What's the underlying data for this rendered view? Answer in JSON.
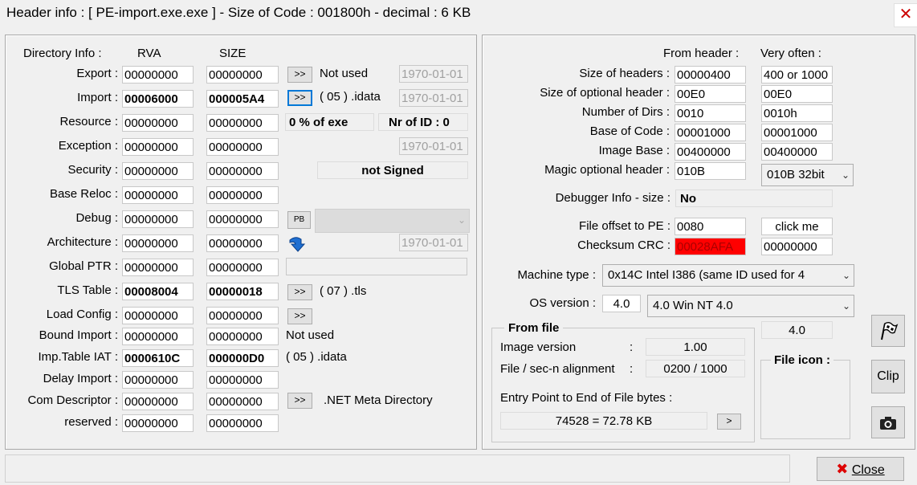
{
  "window": {
    "title": "Header info  : [ PE-import.exe.exe ] - Size of Code : 001800h - decimal : 6 KB",
    "close_glyph": "✕"
  },
  "directory": {
    "header_label": "Directory Info :",
    "rva_label": "RVA",
    "size_label": "SIZE",
    "rows": [
      {
        "label": "Export :",
        "rva": "00000000",
        "size": "00000000",
        "bold": false
      },
      {
        "label": "Import :",
        "rva": "00006000",
        "size": "000005A4",
        "bold": true
      },
      {
        "label": "Resource :",
        "rva": "00000000",
        "size": "00000000",
        "bold": false
      },
      {
        "label": "Exception :",
        "rva": "00000000",
        "size": "00000000",
        "bold": false
      },
      {
        "label": "Security :",
        "rva": "00000000",
        "size": "00000000",
        "bold": false
      },
      {
        "label": "Base Reloc :",
        "rva": "00000000",
        "size": "00000000",
        "bold": false
      },
      {
        "label": "Debug :",
        "rva": "00000000",
        "size": "00000000",
        "bold": false
      },
      {
        "label": "Architecture :",
        "rva": "00000000",
        "size": "00000000",
        "bold": false
      },
      {
        "label": "Global PTR :",
        "rva": "00000000",
        "size": "00000000",
        "bold": false
      },
      {
        "label": "TLS Table :",
        "rva": "00008004",
        "size": "00000018",
        "bold": true
      },
      {
        "label": "Load Config :",
        "rva": "00000000",
        "size": "00000000",
        "bold": false
      },
      {
        "label": "Bound Import :",
        "rva": "00000000",
        "size": "00000000",
        "bold": false
      },
      {
        "label": "Imp.Table IAT :",
        "rva": "0000610C",
        "size": "000000D0",
        "bold": true
      },
      {
        "label": "Delay Import :",
        "rva": "00000000",
        "size": "00000000",
        "bold": false
      },
      {
        "label": "Com Descriptor :",
        "rva": "00000000",
        "size": "00000000",
        "bold": false
      },
      {
        "label": "reserved :",
        "rva": "00000000",
        "size": "00000000",
        "bold": false
      }
    ],
    "export_btn": ">>",
    "export_note": "Not used",
    "export_date": "1970-01-01",
    "import_btn": ">>",
    "import_note": "( 05 ) .idata",
    "import_date": "1970-01-01",
    "resource_pct": "0  % of exe",
    "resource_nrid": "Nr of ID : 0",
    "exception_date": "1970-01-01",
    "security_status": "not Signed",
    "debug_pb": "PB",
    "debug_combo": "",
    "architecture_date": "1970-01-01",
    "tls_btn": ">>",
    "tls_note": "( 07 ) .tls",
    "loadcfg_btn": ">>",
    "bound_note": "Not used",
    "iat_note": "( 05 ) .idata",
    "com_btn": ">>",
    "com_note": ".NET Meta Directory"
  },
  "header": {
    "from_header_label": "From header :",
    "very_often_label": "Very often :",
    "rows": [
      {
        "label": "Size of headers :",
        "value": "00000400",
        "often": "400 or 1000"
      },
      {
        "label": "Size of optional header :",
        "value": "00E0",
        "often": "00E0"
      },
      {
        "label": "Number of Dirs :",
        "value": "0010",
        "often": "0010h"
      },
      {
        "label": "Base of Code :",
        "value": "00001000",
        "often": "00001000"
      },
      {
        "label": "Image Base :",
        "value": "00400000",
        "often": "00400000"
      },
      {
        "label": "Magic optional header :",
        "value": "010B",
        "often": ""
      }
    ],
    "magic_combo": "010B 32bit",
    "debugger_label": "Debugger Info  - size :",
    "debugger_value": "No",
    "file_offset_label": "File offset to PE :",
    "file_offset_value": "0080",
    "click_me": "click me",
    "checksum_label": "Checksum CRC :",
    "checksum_value": "00028AFA",
    "checksum_often": "00000000",
    "machine_label": "Machine type :",
    "machine_value": "0x14C    Intel I386 (same ID used for 4",
    "os_label": "OS version :",
    "os_value": "4.0",
    "os_combo": "4.0   Win NT 4.0",
    "os_extra": "4.0",
    "from_file_title": "From file",
    "image_version_label": "Image version",
    "image_version_colon": ":",
    "image_version_value": "1.00",
    "alignment_label": "File / sec-n alignment",
    "alignment_colon": ":",
    "alignment_value": "0200   /   1000",
    "entry_label": "Entry Point to End of File bytes :",
    "entry_value": "74528  =  72.78 KB",
    "entry_btn": ">",
    "file_icon_label": "File icon :",
    "clip_btn": "Clip"
  },
  "footer": {
    "status_text": "",
    "close_label": "Close"
  },
  "icons": [
    "close-icon",
    "arrow-down-icon",
    "flag-icon",
    "camera-icon",
    "red-x-icon",
    "chevron-down-icon"
  ]
}
